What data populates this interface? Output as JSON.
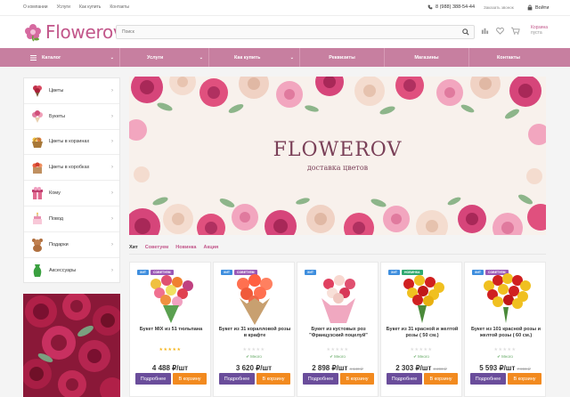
{
  "topbar": {
    "links": [
      "О компании",
      "Услуги",
      "Как купить",
      "Контакты"
    ],
    "phone": "8 (988) 388-54-44",
    "callback": "Заказать звонок",
    "login": "Войти"
  },
  "header": {
    "logo_text": "Flowerov",
    "search_placeholder": "Поиск",
    "cart_label": "Корзина",
    "cart_sub": "пуста"
  },
  "nav": {
    "items": [
      "Каталог",
      "Услуги",
      "Как купить",
      "Реквизиты",
      "Магазины",
      "Контакты"
    ]
  },
  "sidebar": {
    "items": [
      {
        "label": "Цветы",
        "icon": "bouquet-icon"
      },
      {
        "label": "Букеты",
        "icon": "flowers-icon"
      },
      {
        "label": "Цветы в корзинах",
        "icon": "basket-icon"
      },
      {
        "label": "Цветы в коробках",
        "icon": "box-icon"
      },
      {
        "label": "Кому",
        "icon": "gift-icon"
      },
      {
        "label": "Повод",
        "icon": "cake-icon"
      },
      {
        "label": "Подарки",
        "icon": "teddy-bear-icon"
      },
      {
        "label": "Аксессуары",
        "icon": "vase-icon"
      }
    ]
  },
  "banner": {
    "title": "FLOWEROV",
    "subtitle": "доставка цветов"
  },
  "tabs": [
    "Хит",
    "Советуем",
    "Новинка",
    "Акция"
  ],
  "products": [
    {
      "name": "Букет MIX из 51 тюльпана",
      "badges": [
        "ХИТ",
        "СОВЕТУЕМ"
      ],
      "stock": "",
      "price": "4 488 ₽/шт",
      "old_price": "",
      "rated": true
    },
    {
      "name": "Букет из 31 коралловой розы в крафте",
      "badges": [
        "ХИТ",
        "СОВЕТУЕМ"
      ],
      "stock": "✔ Много",
      "price": "3 620 ₽/шт",
      "old_price": "",
      "rated": false
    },
    {
      "name": "Букет из кустовых роз \"Французский поцелуй\"",
      "badges": [
        "ХИТ"
      ],
      "stock": "✔ Много",
      "price": "2 898 ₽/шт",
      "old_price": "4 140 ₽",
      "rated": false
    },
    {
      "name": "Букет из 31 красной и желтой розы ( 50 см.)",
      "badges": [
        "ХИТ",
        "НОВИНКА"
      ],
      "stock": "✔ Много",
      "price": "2 303 ₽/шт",
      "old_price": "3 290 ₽",
      "rated": false
    },
    {
      "name": "Букет из 101 красной розы и желтой розы ( 60 см.)",
      "badges": [
        "ХИТ",
        "СОВЕТУЕМ"
      ],
      "stock": "✔ Много",
      "price": "5 593 ₽/шт",
      "old_price": "7 990 ₽",
      "rated": false
    }
  ],
  "buttons": {
    "more": "Подробнее",
    "cart": "В корзину"
  },
  "colors": {
    "brand": "#c2568a",
    "nav": "#c77fa0",
    "more_btn": "#6a4d9b",
    "cart_btn": "#f28a1f"
  }
}
